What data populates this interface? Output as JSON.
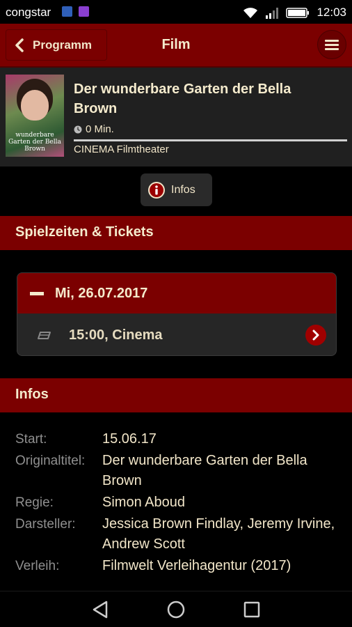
{
  "status_bar": {
    "carrier": "congstar",
    "time": "12:03"
  },
  "header": {
    "back_label": "Programm",
    "title": "Film"
  },
  "film": {
    "title": "Der wunderbare Garten der Bella Brown",
    "duration": "0 Min.",
    "cinema": "CINEMA Filmtheater",
    "poster_text": "wunderbare Garten der Bella Brown",
    "progress": 1.0
  },
  "infos_button": {
    "label": "Infos"
  },
  "showtimes": {
    "section_title": "Spielzeiten & Tickets",
    "days": [
      {
        "date": "Mi, 26.07.2017",
        "shows": [
          {
            "time": "15:00, Cinema"
          }
        ]
      }
    ]
  },
  "infos": {
    "section_title": "Infos",
    "rows": [
      {
        "label": "Start:",
        "value": "15.06.17"
      },
      {
        "label": "Originaltitel:",
        "value": "Der wunderbare Garten der Bella Brown"
      },
      {
        "label": "Regie:",
        "value": "Simon Aboud"
      },
      {
        "label": "Darsteller:",
        "value": "Jessica Brown Findlay, Jeremy Irvine, Andrew Scott"
      },
      {
        "label": "Verleih:",
        "value": "Filmwelt Verleihagentur (2017)"
      }
    ]
  },
  "colors": {
    "accent": "#7b0000",
    "text": "#f2e6c9",
    "label": "#8f8f8f"
  }
}
